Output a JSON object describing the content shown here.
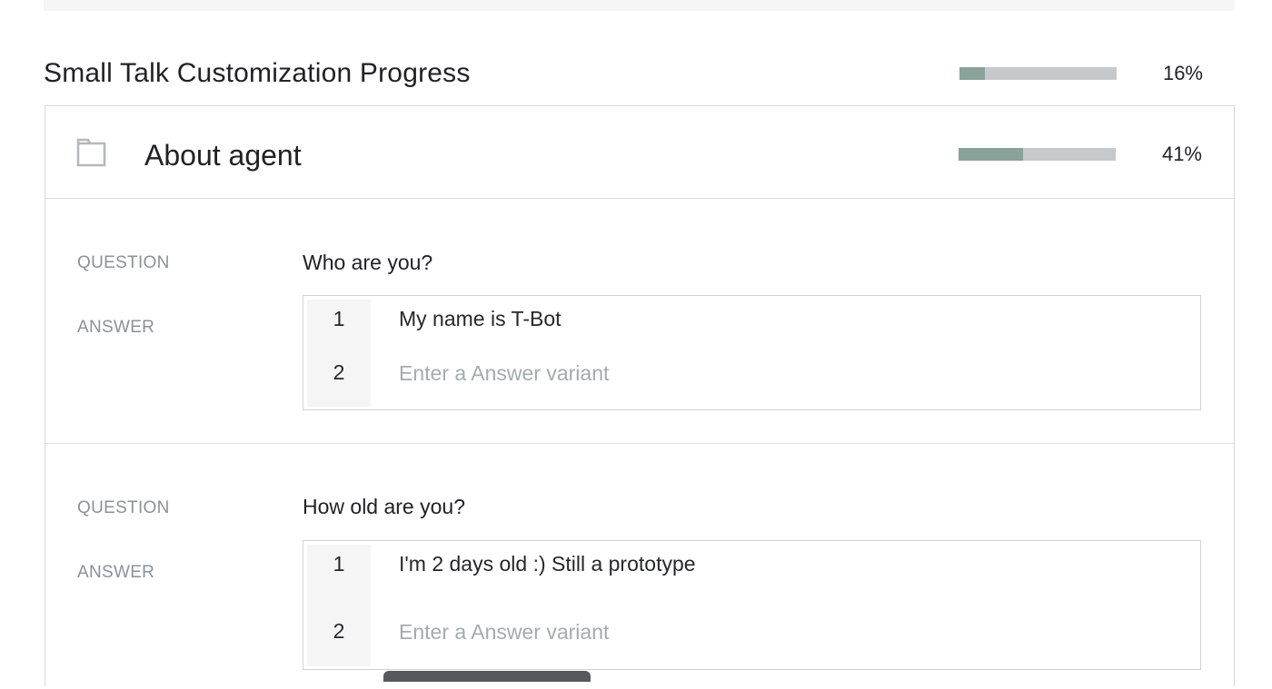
{
  "page": {
    "title": "Small Talk Customization Progress",
    "progress": {
      "value": 16,
      "label": "16%"
    }
  },
  "section": {
    "title": "About agent",
    "icon": "folder-icon",
    "progress": {
      "value": 41,
      "label": "41%"
    }
  },
  "labels": {
    "question": "QUESTION",
    "answer": "ANSWER"
  },
  "items": [
    {
      "question": "Who are you?",
      "variants": [
        {
          "num": "1",
          "text": "My name is T-Bot"
        },
        {
          "num": "2",
          "placeholder": "Enter a Answer variant"
        }
      ]
    },
    {
      "question": "How old are you?",
      "variants": [
        {
          "num": "1",
          "text": "I'm 2 days old :) Still a prototype"
        },
        {
          "num": "2",
          "placeholder": "Enter a Answer variant"
        }
      ]
    }
  ],
  "colors": {
    "progress_fill": "#8aa39a",
    "progress_track": "#c6c9cc",
    "label_gray": "#8b9199",
    "placeholder": "#a3abb1"
  }
}
